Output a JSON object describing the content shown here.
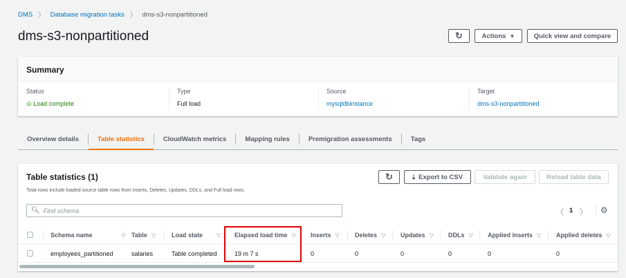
{
  "breadcrumb": [
    "DMS",
    "Database migration tasks",
    "dms-s3-nonpartitioned"
  ],
  "title": "dms-s3-nonpartitioned",
  "header_buttons": {
    "actions": "Actions",
    "quick_view": "Quick view and compare"
  },
  "summary": {
    "title": "Summary",
    "status_label": "Status",
    "status_value": "Load complete",
    "type_label": "Type",
    "type_value": "Full load",
    "source_label": "Source",
    "source_value": "mysqldbinstance",
    "target_label": "Target",
    "target_value": "dms-s3-nonpartitioned"
  },
  "tabs": [
    "Overview details",
    "Table statistics",
    "CloudWatch metrics",
    "Mapping rules",
    "Premigration assessments",
    "Tags"
  ],
  "active_tab": "Table statistics",
  "table_stats": {
    "title": "Table statistics (1)",
    "description": "Total rows include loaded source table rows from Inserts, Deletes, Updates, DDLs, and Full load rows.",
    "export": "Export to CSV",
    "validate": "Validate again",
    "reload": "Reload table data",
    "search_placeholder": "Find schema",
    "page": "1",
    "columns": [
      "Schema name",
      "Table",
      "Load state",
      "Elapsed load time",
      "Inserts",
      "Deletes",
      "Updates",
      "DDLs",
      "Applied inserts",
      "Applied deletes"
    ],
    "rows": [
      [
        "employees_partitioned",
        "salaries",
        "Table completed",
        "19 m 7 s",
        "0",
        "0",
        "0",
        "0",
        "0",
        "0"
      ]
    ]
  },
  "colors": {
    "accent": "#ec7211",
    "link": "#0073bb",
    "success": "#1d8102",
    "highlight": "#e00000"
  }
}
